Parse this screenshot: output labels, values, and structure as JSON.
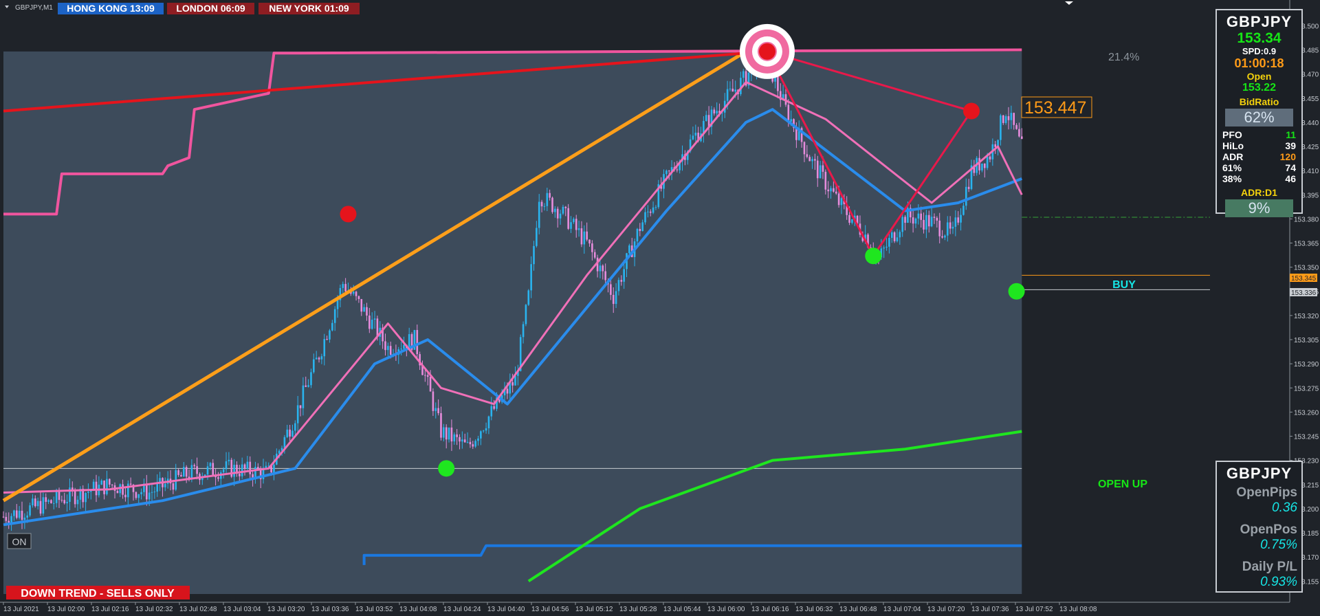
{
  "window": {
    "symbol_label": "GBPJPY,M1"
  },
  "sessions": [
    {
      "label": "HONG KONG  13:09",
      "color": "#1c63c6"
    },
    {
      "label": "LONDON  06:09",
      "color": "#8e1d22"
    },
    {
      "label": "NEW YORK  01:09",
      "color": "#8e1d22"
    }
  ],
  "info_panel": {
    "symbol": "GBPJPY",
    "bid": "153.34",
    "spread": "SPD:0.9",
    "timer": "01:00:18",
    "open_label": "Open",
    "open_value": "153.22",
    "bid_ratio_label": "BidRatio",
    "bid_ratio_value": "62%",
    "stats": [
      {
        "label": "PFO",
        "value": "11",
        "color": "#16e516"
      },
      {
        "label": "HiLo",
        "value": "39",
        "color": "#ffffff"
      },
      {
        "label": "ADR",
        "value": "120",
        "color": "#ff9b18"
      },
      {
        "label": "61%",
        "value": "74",
        "color": "#ffffff"
      },
      {
        "label": "38%",
        "value": "46",
        "color": "#ffffff"
      }
    ],
    "adr_d1_label": "ADR:D1",
    "adr_d1_value": "9%"
  },
  "position_panel": {
    "symbol": "GBPJPY",
    "open_pips_label": "OpenPips",
    "open_pips_value": "0.36",
    "open_pos_label": "OpenPos",
    "open_pos_value": "0.75%",
    "daily_pl_label": "Daily P/L",
    "daily_pl_value": "0.93%"
  },
  "annotations": {
    "percent_label": "21.4%",
    "price_label": "153.447",
    "buy_label": "BUY",
    "open_up_label": "OPEN UP",
    "trend_banner": "DOWN TREND - SELLS ONLY",
    "on_label": "ON",
    "price_tag_1": "153.345",
    "price_tag_2": "153.336"
  },
  "chart_data": {
    "type": "candlestick",
    "symbol": "GBPJPY",
    "timeframe": "M1",
    "ylim": [
      153.147,
      153.507
    ],
    "y_ticks": [
      "153.500",
      "153.485",
      "153.470",
      "153.455",
      "153.440",
      "153.425",
      "153.410",
      "153.395",
      "153.380",
      "153.365",
      "153.350",
      "153.335",
      "153.320",
      "153.305",
      "153.290",
      "153.275",
      "153.260",
      "153.245",
      "153.230",
      "153.215",
      "153.200",
      "153.185",
      "153.170",
      "153.155"
    ],
    "x_ticks": [
      "13 Jul 2021",
      "13 Jul 02:00",
      "13 Jul 02:16",
      "13 Jul 02:32",
      "13 Jul 02:48",
      "13 Jul 03:04",
      "13 Jul 03:20",
      "13 Jul 03:36",
      "13 Jul 03:52",
      "13 Jul 04:08",
      "13 Jul 04:24",
      "13 Jul 04:40",
      "13 Jul 04:56",
      "13 Jul 05:12",
      "13 Jul 05:28",
      "13 Jul 05:44",
      "13 Jul 06:00",
      "13 Jul 06:16",
      "13 Jul 06:32",
      "13 Jul 06:48",
      "13 Jul 07:04",
      "13 Jul 07:20",
      "13 Jul 07:36",
      "13 Jul 07:52",
      "13 Jul 08:08"
    ],
    "price_path_keypoints": [
      [
        0,
        153.195
      ],
      [
        20,
        153.205
      ],
      [
        40,
        153.215
      ],
      [
        55,
        153.21
      ],
      [
        70,
        153.222
      ],
      [
        85,
        153.225
      ],
      [
        100,
        153.222
      ],
      [
        110,
        153.258
      ],
      [
        120,
        153.3
      ],
      [
        128,
        153.34
      ],
      [
        135,
        153.325
      ],
      [
        145,
        153.3
      ],
      [
        155,
        153.305
      ],
      [
        165,
        153.248
      ],
      [
        175,
        153.238
      ],
      [
        185,
        153.262
      ],
      [
        193,
        153.28
      ],
      [
        198,
        153.332
      ],
      [
        202,
        153.395
      ],
      [
        210,
        153.385
      ],
      [
        220,
        153.365
      ],
      [
        230,
        153.332
      ],
      [
        240,
        153.375
      ],
      [
        250,
        153.405
      ],
      [
        260,
        153.43
      ],
      [
        270,
        153.45
      ],
      [
        280,
        153.468
      ],
      [
        285,
        153.482
      ],
      [
        290,
        153.47
      ],
      [
        295,
        153.448
      ],
      [
        305,
        153.415
      ],
      [
        315,
        153.39
      ],
      [
        325,
        153.37
      ],
      [
        330,
        153.355
      ],
      [
        340,
        153.382
      ],
      [
        350,
        153.378
      ],
      [
        358,
        153.37
      ],
      [
        365,
        153.41
      ],
      [
        372,
        153.42
      ],
      [
        378,
        153.448
      ],
      [
        385,
        153.42
      ],
      [
        390,
        153.402
      ],
      [
        395,
        153.36
      ],
      [
        400,
        153.337
      ]
    ],
    "series": [
      {
        "name": "",
        "color": "#f0559e",
        "values": [
          [
            0,
            153.383
          ],
          [
            20,
            153.383
          ],
          [
            22,
            153.408
          ],
          [
            60,
            153.408
          ],
          [
            62,
            153.413
          ],
          [
            70,
            153.418
          ],
          [
            72,
            153.448
          ],
          [
            100,
            153.458
          ],
          [
            102,
            153.483
          ],
          [
            112,
            153.483
          ],
          [
            384,
            153.485
          ]
        ]
      },
      {
        "name": "",
        "color": "#1b78e0",
        "values": [
          [
            136,
            153.165
          ],
          [
            136,
            153.171
          ],
          [
            180,
            153.171
          ],
          [
            182,
            153.177
          ],
          [
            384,
            153.177
          ]
        ]
      },
      {
        "name": "",
        "color": "#1fe61f",
        "values": [
          [
            198,
            153.155
          ],
          [
            240,
            153.2
          ],
          [
            290,
            153.23
          ],
          [
            340,
            153.237
          ],
          [
            384,
            153.248
          ]
        ]
      },
      {
        "name": "",
        "color": "#2a8cec",
        "values": [
          [
            0,
            153.19
          ],
          [
            60,
            153.205
          ],
          [
            110,
            153.225
          ],
          [
            140,
            153.29
          ],
          [
            160,
            153.305
          ],
          [
            190,
            153.265
          ],
          [
            220,
            153.325
          ],
          [
            250,
            153.385
          ],
          [
            280,
            153.44
          ],
          [
            290,
            153.448
          ],
          [
            340,
            153.385
          ],
          [
            360,
            153.39
          ],
          [
            384,
            153.405
          ]
        ]
      },
      {
        "name": "",
        "color": "#f070b8",
        "values": [
          [
            0,
            153.21
          ],
          [
            40,
            153.212
          ],
          [
            100,
            153.225
          ],
          [
            145,
            153.315
          ],
          [
            165,
            153.275
          ],
          [
            185,
            153.265
          ],
          [
            220,
            153.345
          ],
          [
            280,
            153.465
          ],
          [
            310,
            153.442
          ],
          [
            350,
            153.39
          ],
          [
            375,
            153.425
          ],
          [
            384,
            153.395
          ]
        ]
      },
      {
        "name": "",
        "color": "#ff9f1a",
        "values": [
          [
            0,
            153.205
          ],
          [
            280,
            153.484
          ]
        ]
      },
      {
        "name": "",
        "color": "#e5141c",
        "values": [
          [
            0,
            153.447
          ],
          [
            288,
            153.484
          ]
        ]
      },
      {
        "name": "",
        "color": "#e8194a",
        "values": [
          [
            288,
            153.484
          ],
          [
            365,
            153.447
          ],
          [
            328,
            153.357
          ],
          [
            288,
            153.484
          ]
        ]
      }
    ],
    "markers": [
      {
        "type": "high",
        "color": "#e5141c",
        "x": 130,
        "y": 153.383
      },
      {
        "type": "high",
        "color": "#e5141c",
        "x": 288,
        "y": 153.484
      },
      {
        "type": "high",
        "color": "#e5141c",
        "x": 365,
        "y": 153.447
      },
      {
        "type": "low",
        "color": "#1fe61f",
        "x": 167,
        "y": 153.225
      },
      {
        "type": "low",
        "color": "#1fe61f",
        "x": 328,
        "y": 153.357
      },
      {
        "type": "low",
        "color": "#1fe61f",
        "x": 382,
        "y": 153.335
      }
    ],
    "levels": [
      {
        "value": 153.225,
        "color": "#c9cdd2",
        "style": "solid"
      },
      {
        "value": 153.381,
        "color": "#36a336",
        "style": "dash-dot"
      },
      {
        "value": 153.345,
        "color": "#ff9b18",
        "style": "solid"
      },
      {
        "value": 153.336,
        "color": "#c9cdd2",
        "style": "solid"
      }
    ],
    "grid": false,
    "legend": "none"
  }
}
